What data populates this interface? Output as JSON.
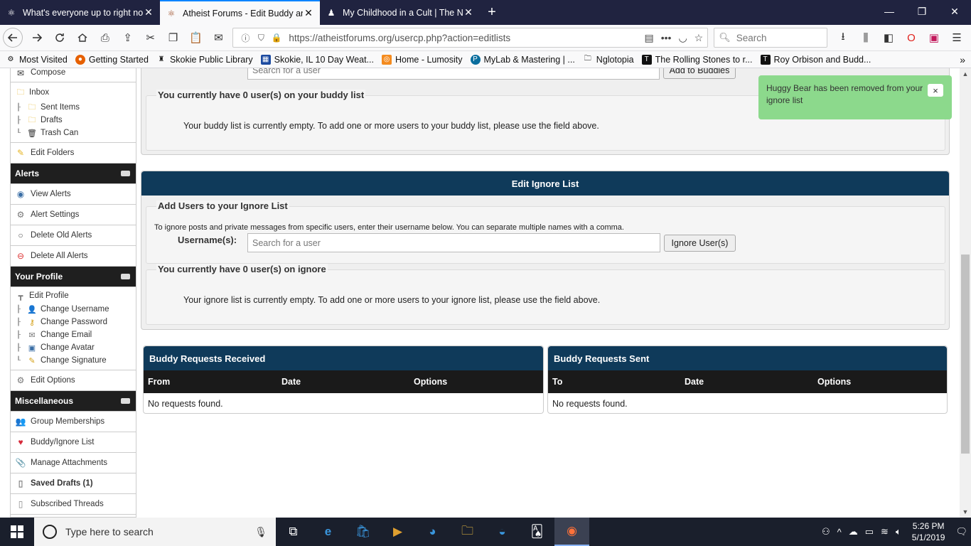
{
  "browser": {
    "tabs": [
      {
        "title": "What's everyone up to right no"
      },
      {
        "title": "Atheist Forums - Edit Buddy an"
      },
      {
        "title": "My Childhood in a Cult | The N"
      }
    ],
    "url": "https://atheistforums.org/usercp.php?action=editlists",
    "search_placeholder": "Search",
    "bookmarks": [
      {
        "label": "Most Visited"
      },
      {
        "label": "Getting Started"
      },
      {
        "label": "Skokie Public Library"
      },
      {
        "label": "Skokie, IL 10 Day Weat..."
      },
      {
        "label": "Home - Lumosity"
      },
      {
        "label": "MyLab & Mastering | ..."
      },
      {
        "label": "Nglotopia"
      },
      {
        "label": "The Rolling Stones to r..."
      },
      {
        "label": "Roy Orbison and Budd..."
      }
    ]
  },
  "sidebar": {
    "compose": "Compose",
    "inbox": "Inbox",
    "sent_items": "Sent Items",
    "drafts": "Drafts",
    "trash_can": "Trash Can",
    "edit_folders": "Edit Folders",
    "alerts_header": "Alerts",
    "view_alerts": "View Alerts",
    "alert_settings": "Alert Settings",
    "delete_old_alerts": "Delete Old Alerts",
    "delete_all_alerts": "Delete All Alerts",
    "profile_header": "Your Profile",
    "edit_profile": "Edit Profile",
    "change_username": "Change Username",
    "change_password": "Change Password",
    "change_email": "Change Email",
    "change_avatar": "Change Avatar",
    "change_signature": "Change Signature",
    "edit_options": "Edit Options",
    "misc_header": "Miscellaneous",
    "group_memberships": "Group Memberships",
    "buddy_ignore_list": "Buddy/Ignore List",
    "manage_attachments": "Manage Attachments",
    "saved_drafts": "Saved Drafts (1)",
    "subscribed_threads": "Subscribed Threads"
  },
  "buddy": {
    "search_placeholder": "Search for a user",
    "add_button": "Add to Buddies",
    "count_legend": "You currently have 0 user(s) on your buddy list",
    "empty_text": "Your buddy list is currently empty. To add one or more users to your buddy list, please use the field above."
  },
  "ignore": {
    "header": "Edit Ignore List",
    "add_legend": "Add Users to your Ignore List",
    "instructions": "To ignore posts and private messages from specific users, enter their username below. You can separate multiple names with a comma.",
    "username_label": "Username(s):",
    "search_placeholder": "Search for a user",
    "button": "Ignore User(s)",
    "count_legend": "You currently have 0 user(s) on ignore",
    "empty_text": "Your ignore list is currently empty. To add one or more users to your ignore list, please use the field above."
  },
  "requests_received": {
    "header": "Buddy Requests Received",
    "columns": [
      "From",
      "Date",
      "Options"
    ],
    "empty": "No requests found."
  },
  "requests_sent": {
    "header": "Buddy Requests Sent",
    "columns": [
      "To",
      "Date",
      "Options"
    ],
    "empty": "No requests found."
  },
  "toast": {
    "message": "Huggy Bear has been removed from your ignore list",
    "close": "×"
  },
  "taskbar": {
    "search_placeholder": "Type here to search",
    "time": "5:26 PM",
    "date": "5/1/2019"
  }
}
